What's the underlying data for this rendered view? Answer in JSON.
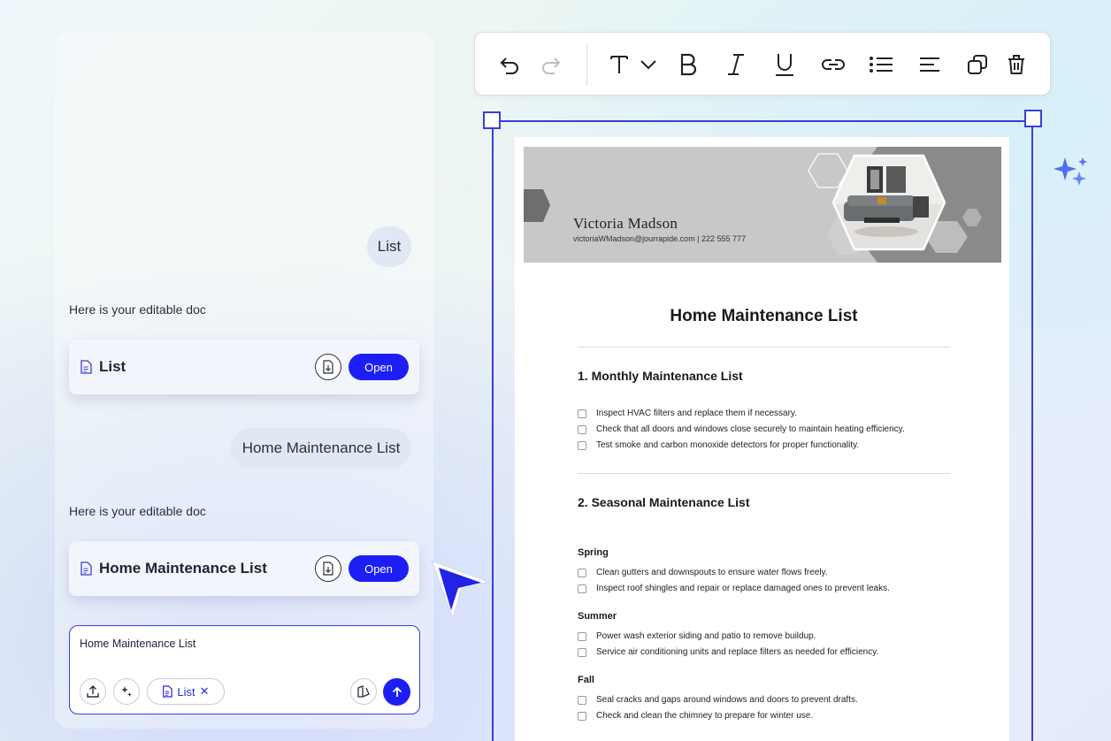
{
  "chat": {
    "messages": [
      {
        "role": "user",
        "text": "List"
      },
      {
        "role": "assistant",
        "text": "Here is your editable doc",
        "doc_title": "List",
        "open_label": "Open"
      },
      {
        "role": "user",
        "text": "Home Maintenance List"
      },
      {
        "role": "assistant",
        "text": "Here is your editable doc",
        "doc_title": "Home Maintenance List",
        "open_label": "Open"
      }
    ],
    "input": {
      "value": "Home Maintenance List",
      "chip_label": "List",
      "chip_close": "✕"
    }
  },
  "toolbar": {
    "buttons": [
      "undo-icon",
      "redo-icon",
      "text-style-icon",
      "chevron-down-icon",
      "bold-icon",
      "italic-icon",
      "underline-icon",
      "link-icon",
      "bullet-list-icon",
      "align-icon",
      "duplicate-icon",
      "delete-icon"
    ]
  },
  "document": {
    "banner": {
      "name": "Victoria Madson",
      "contact": "victoriaWMadson@jourrapide.com | 222 555 777"
    },
    "title": "Home Maintenance List",
    "sections": [
      {
        "heading": "1. Monthly Maintenance List",
        "items": [
          "Inspect HVAC filters and replace them if necessary.",
          "Check that all doors and windows close securely to maintain heating efficiency.",
          "Test smoke and carbon monoxide detectors for proper functionality."
        ]
      },
      {
        "heading": "2. Seasonal Maintenance List",
        "groups": [
          {
            "name": "Spring",
            "items": [
              "Clean gutters and downspouts to ensure water flows freely.",
              "Inspect roof shingles and repair or replace damaged ones to prevent leaks."
            ]
          },
          {
            "name": "Summer",
            "items": [
              "Power wash exterior siding and patio to remove buildup.",
              "Service air conditioning units and replace filters as needed for efficiency."
            ]
          },
          {
            "name": "Fall",
            "items": [
              "Seal cracks and gaps around windows and doors to prevent drafts.",
              "Check and clean the chimney to prepare for winter use."
            ]
          }
        ]
      }
    ]
  },
  "colors": {
    "accent": "#1d1ef5",
    "selection": "#3b3ed6",
    "bubble": "#dfe8f3"
  }
}
